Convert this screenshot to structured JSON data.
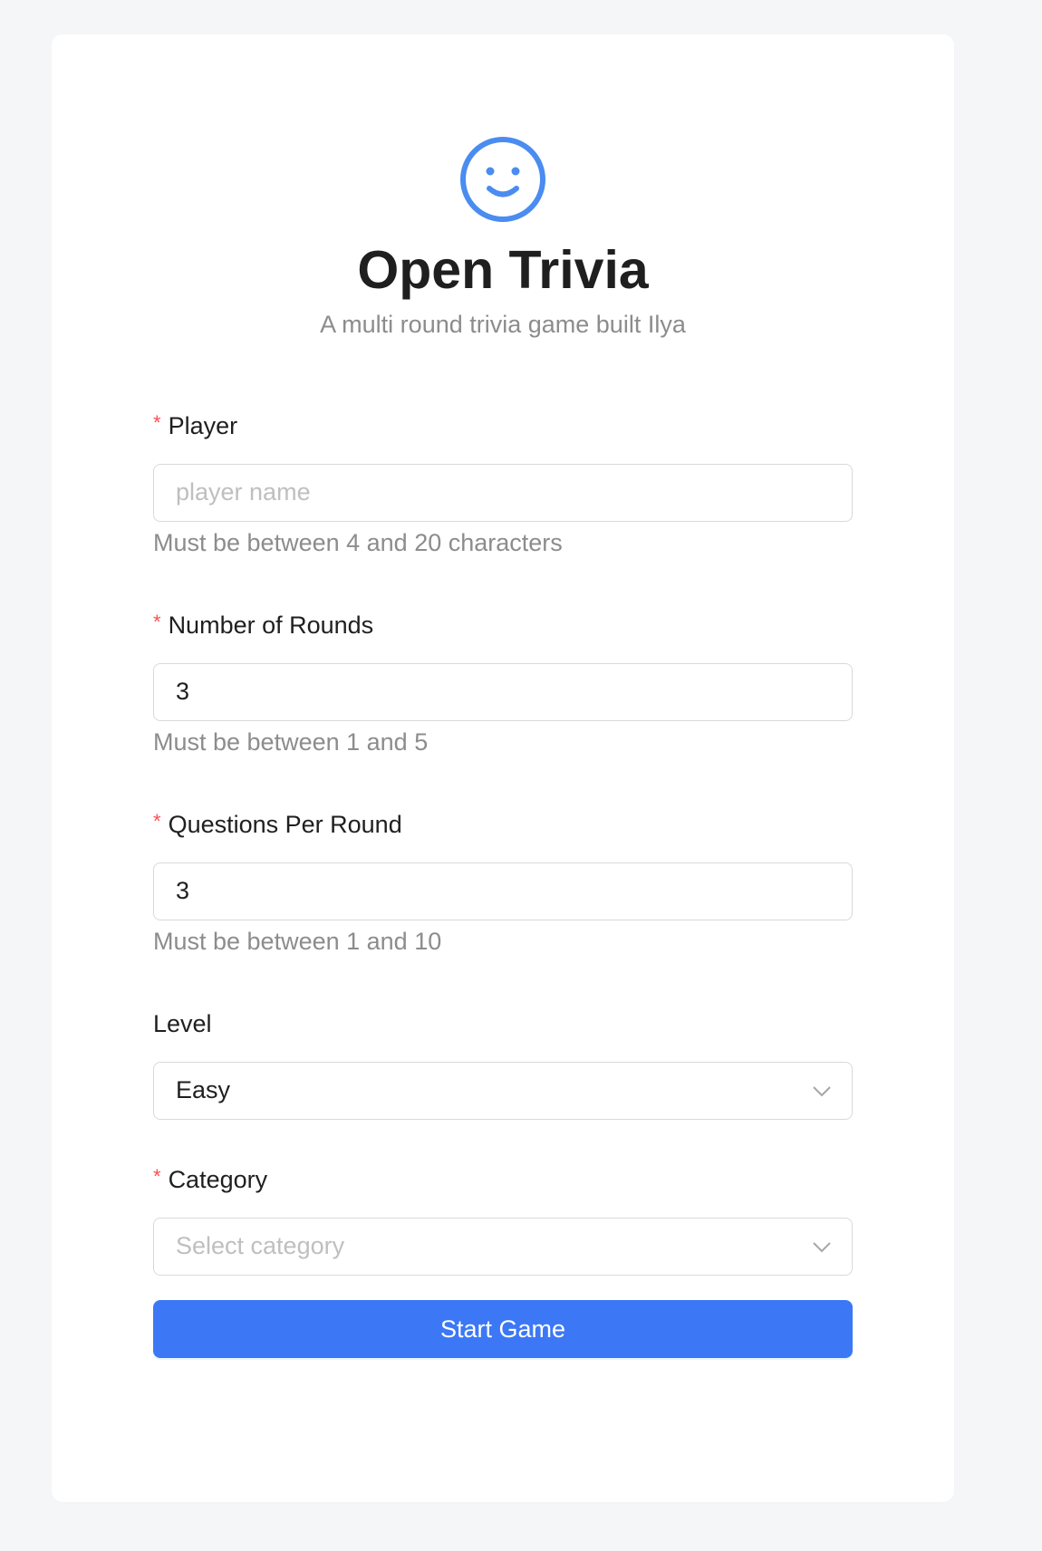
{
  "header": {
    "title": "Open Trivia",
    "subtitle": "A multi round trivia game built Ilya",
    "logo_icon": "smiley-face-icon",
    "accent_color": "#3c78f5"
  },
  "form": {
    "player": {
      "label": "Player",
      "required_mark": "*",
      "value": "",
      "placeholder": "player name",
      "help": "Must be between 4 and 20 characters"
    },
    "rounds": {
      "label": "Number of Rounds",
      "required_mark": "*",
      "value": "3",
      "help": "Must be between 1 and 5"
    },
    "questions": {
      "label": "Questions Per Round",
      "required_mark": "*",
      "value": "3",
      "help": "Must be between 1 and 10"
    },
    "level": {
      "label": "Level",
      "value": "Easy",
      "icon": "chevron-down-icon"
    },
    "category": {
      "label": "Category",
      "required_mark": "*",
      "placeholder": "Select category",
      "icon": "chevron-down-icon"
    },
    "submit_label": "Start Game"
  }
}
